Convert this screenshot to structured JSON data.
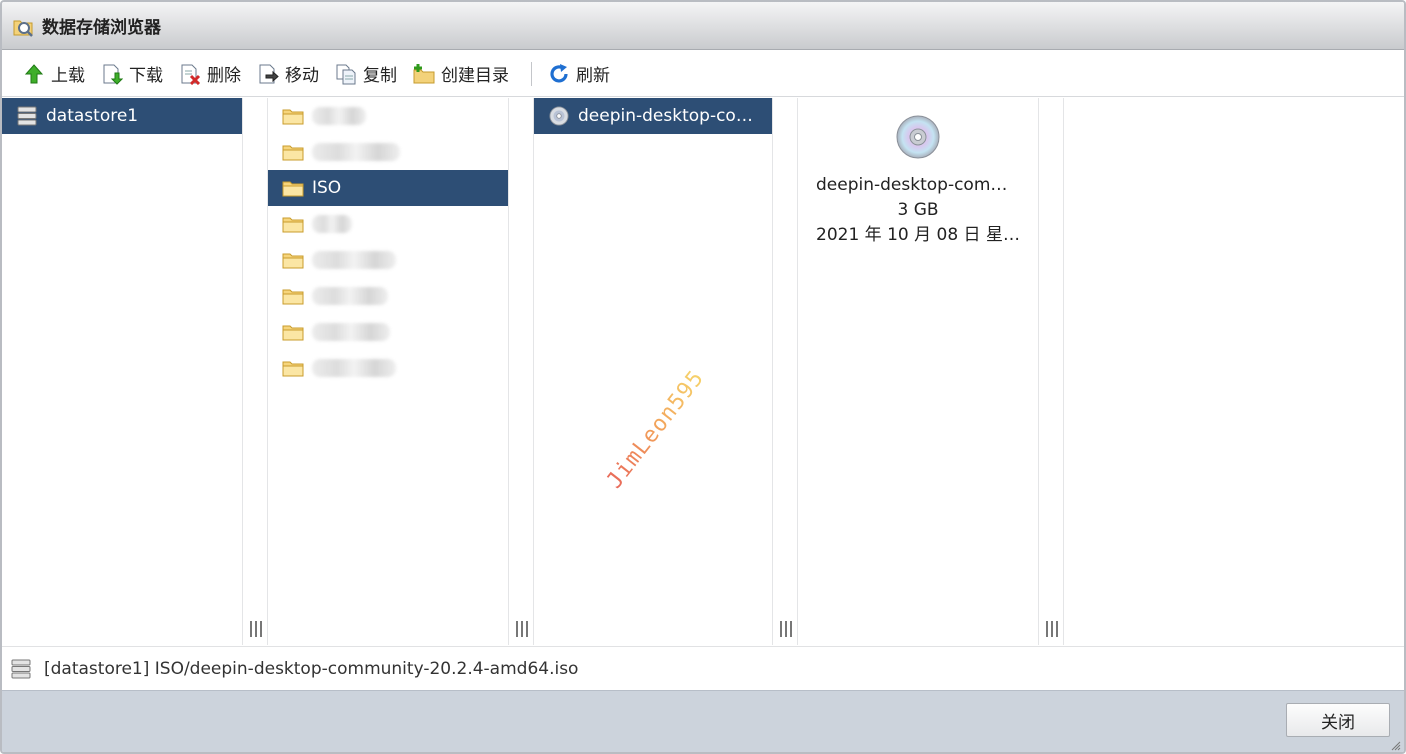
{
  "window": {
    "title": "数据存储浏览器"
  },
  "toolbar": {
    "upload": "上载",
    "download": "下载",
    "delete": "删除",
    "move": "移动",
    "copy": "复制",
    "mkdir": "创建目录",
    "refresh": "刷新"
  },
  "columns": {
    "datastores": [
      {
        "name": "datastore1",
        "selected": true
      }
    ],
    "folders": [
      {
        "name": "",
        "blurred": true
      },
      {
        "name": "",
        "blurred": true
      },
      {
        "name": "ISO",
        "selected": true
      },
      {
        "name": "",
        "blurred": true
      },
      {
        "name": "",
        "blurred": true
      },
      {
        "name": "",
        "blurred": true
      },
      {
        "name": "",
        "blurred": true
      },
      {
        "name": "",
        "blurred": true
      }
    ],
    "files": [
      {
        "name": "deepin-desktop-co…",
        "selected": true,
        "icon": "disc-icon"
      }
    ],
    "preview": {
      "name": "deepin-desktop-comm…",
      "size": "3 GB",
      "date": "2021 年 10 月 08 日 星…",
      "icon": "disc-icon"
    }
  },
  "watermark": "JimLeon595",
  "status": {
    "path": "[datastore1] ISO/deepin-desktop-community-20.2.4-amd64.iso"
  },
  "footer": {
    "close": "关闭"
  },
  "colors": {
    "selection": "#2d4e75",
    "footer": "#ccd3dc",
    "titlebar": "#c9cbce"
  }
}
